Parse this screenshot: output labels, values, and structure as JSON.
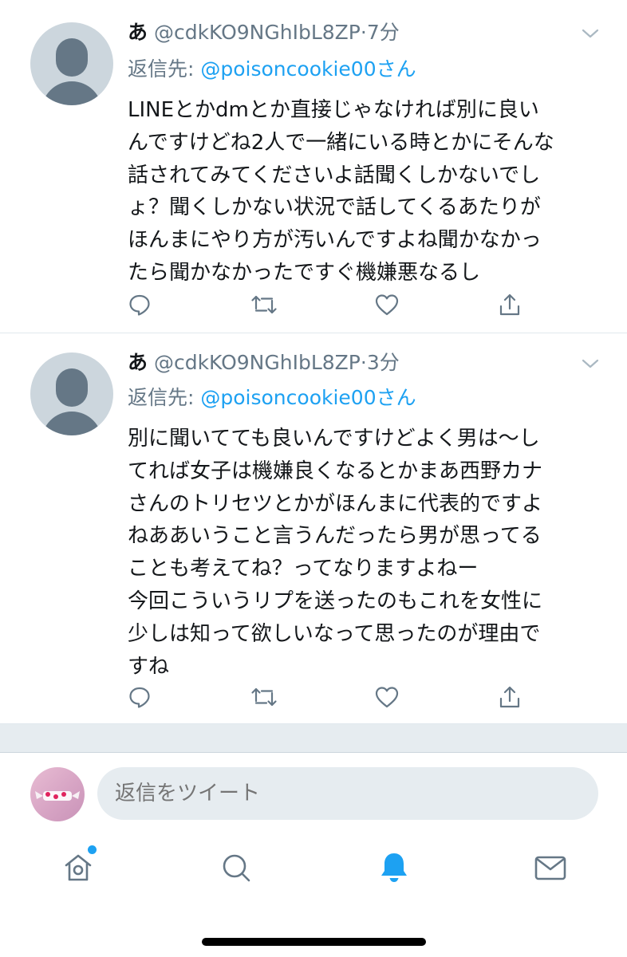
{
  "tweets": [
    {
      "display_name": "あ",
      "handle": "@cdkKO9NGhIbL8ZP",
      "separator": "·",
      "time": "7分",
      "reply_prefix": "返信先: ",
      "reply_to": "@poisoncookie00さん",
      "text": "LINEとかdmとか直接じゃなければ別に良い\nんですけどね2人で一緒にいる時とかにそんな\n話されてみてくださいよ話聞くしかないでし\nょ？聞くしかない状況で話してくるあたりが\nほんまにやり方が汚いんですよね聞かなかっ\nたら聞かなかったですぐ機嫌悪なるし"
    },
    {
      "display_name": "あ",
      "handle": "@cdkKO9NGhIbL8ZP",
      "separator": "·",
      "time": "3分",
      "reply_prefix": "返信先: ",
      "reply_to": "@poisoncookie00さん",
      "text": "別に聞いてても良いんですけどよく男は〜し\nてれば女子は機嫌良くなるとかまあ西野カナ\nさんのトリセツとかがほんまに代表的ですよ\nねああいうこと言うんだったら男が思ってる\nことも考えてね？ってなりますよねー\n今回こういうリプを送ったのもこれを女性に\n少しは知って欲しいなって思ったのが理由で\nすね"
    }
  ],
  "composer": {
    "placeholder": "返信をツイート"
  },
  "tabbar": {
    "items": [
      "home-icon",
      "search-icon",
      "notifications-bell-icon",
      "messages-envelope-icon"
    ],
    "active": "notifications-bell-icon",
    "home_has_new_indicator": true
  },
  "colors": {
    "accent": "#1da1f2",
    "secondary_text": "#657786",
    "icon_gray": "#657786",
    "divider": "#e1e8ed"
  }
}
